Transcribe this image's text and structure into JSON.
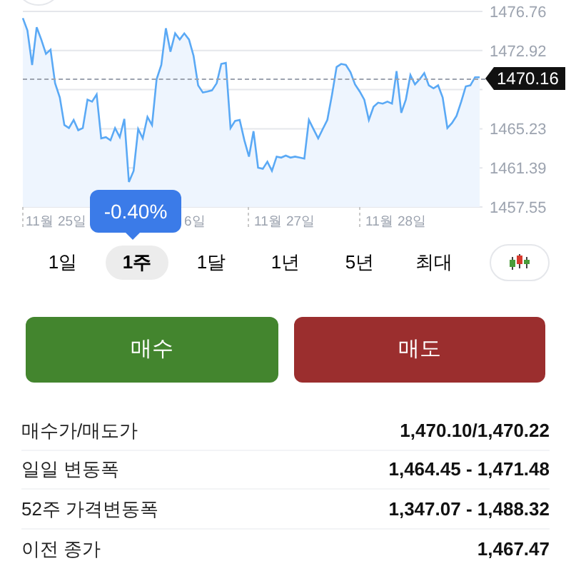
{
  "chart": {
    "chart_data": {
      "type": "area",
      "ylim": [
        1457.55,
        1476.76
      ],
      "grid": true,
      "yticks": [
        1476.76,
        1472.92,
        1465.23,
        1461.39,
        1457.55
      ],
      "values": [
        1476.1,
        1474.9,
        1471.5,
        1475.2,
        1474.0,
        1472.6,
        1473.0,
        1469.7,
        1468.3,
        1465.6,
        1465.3,
        1466.1,
        1465.1,
        1465.3,
        1468.1,
        1467.9,
        1468.6,
        1464.3,
        1464.4,
        1464.1,
        1465.3,
        1464.4,
        1466.2,
        1460.0,
        1461.1,
        1465.2,
        1464.3,
        1466.4,
        1465.6,
        1470.1,
        1471.5,
        1475.1,
        1472.8,
        1474.6,
        1474.0,
        1474.6,
        1474.0,
        1472.4,
        1469.5,
        1468.8,
        1468.9,
        1469.0,
        1469.7,
        1471.6,
        1471.7,
        1465.3,
        1466.0,
        1466.1,
        1464.1,
        1462.5,
        1465.0,
        1461.4,
        1461.3,
        1462.0,
        1461.1,
        1462.5,
        1462.4,
        1462.6,
        1462.4,
        1462.5,
        1462.4,
        1462.3,
        1466.1,
        1465.2,
        1464.3,
        1465.2,
        1466.1,
        1468.6,
        1471.3,
        1471.6,
        1471.5,
        1470.8,
        1469.6,
        1468.9,
        1468.1,
        1466.1,
        1467.4,
        1467.8,
        1467.7,
        1467.9,
        1467.7,
        1470.9,
        1466.8,
        1468.1,
        1470.5,
        1469.6,
        1470.1,
        1470.7,
        1469.5,
        1469.2,
        1469.5,
        1468.3,
        1465.3,
        1465.8,
        1466.5,
        1467.9,
        1469.4,
        1469.5,
        1470.3,
        1470.3
      ]
    },
    "x_labels": [
      "11월 25일",
      "6일",
      "11월 27일",
      "11월 28일"
    ],
    "current_price": "1470.16",
    "change_tooltip": "-0.40%"
  },
  "ranges": [
    {
      "label": "1일",
      "selected": false
    },
    {
      "label": "1주",
      "selected": true
    },
    {
      "label": "1달",
      "selected": false
    },
    {
      "label": "1년",
      "selected": false
    },
    {
      "label": "5년",
      "selected": false
    },
    {
      "label": "최대",
      "selected": false
    }
  ],
  "actions": [
    {
      "label": "매수",
      "kind": "buy"
    },
    {
      "label": "매도",
      "kind": "sell"
    }
  ],
  "stats": [
    {
      "label": "매수가/매도가",
      "value": "1,470.10/1,470.22"
    },
    {
      "label": "일일 변동폭",
      "value": "1,464.45 - 1,471.48"
    },
    {
      "label": "52주 가격변동폭",
      "value": "1,347.07 - 1,488.32"
    },
    {
      "label": "이전 종가",
      "value": "1,467.47"
    }
  ]
}
